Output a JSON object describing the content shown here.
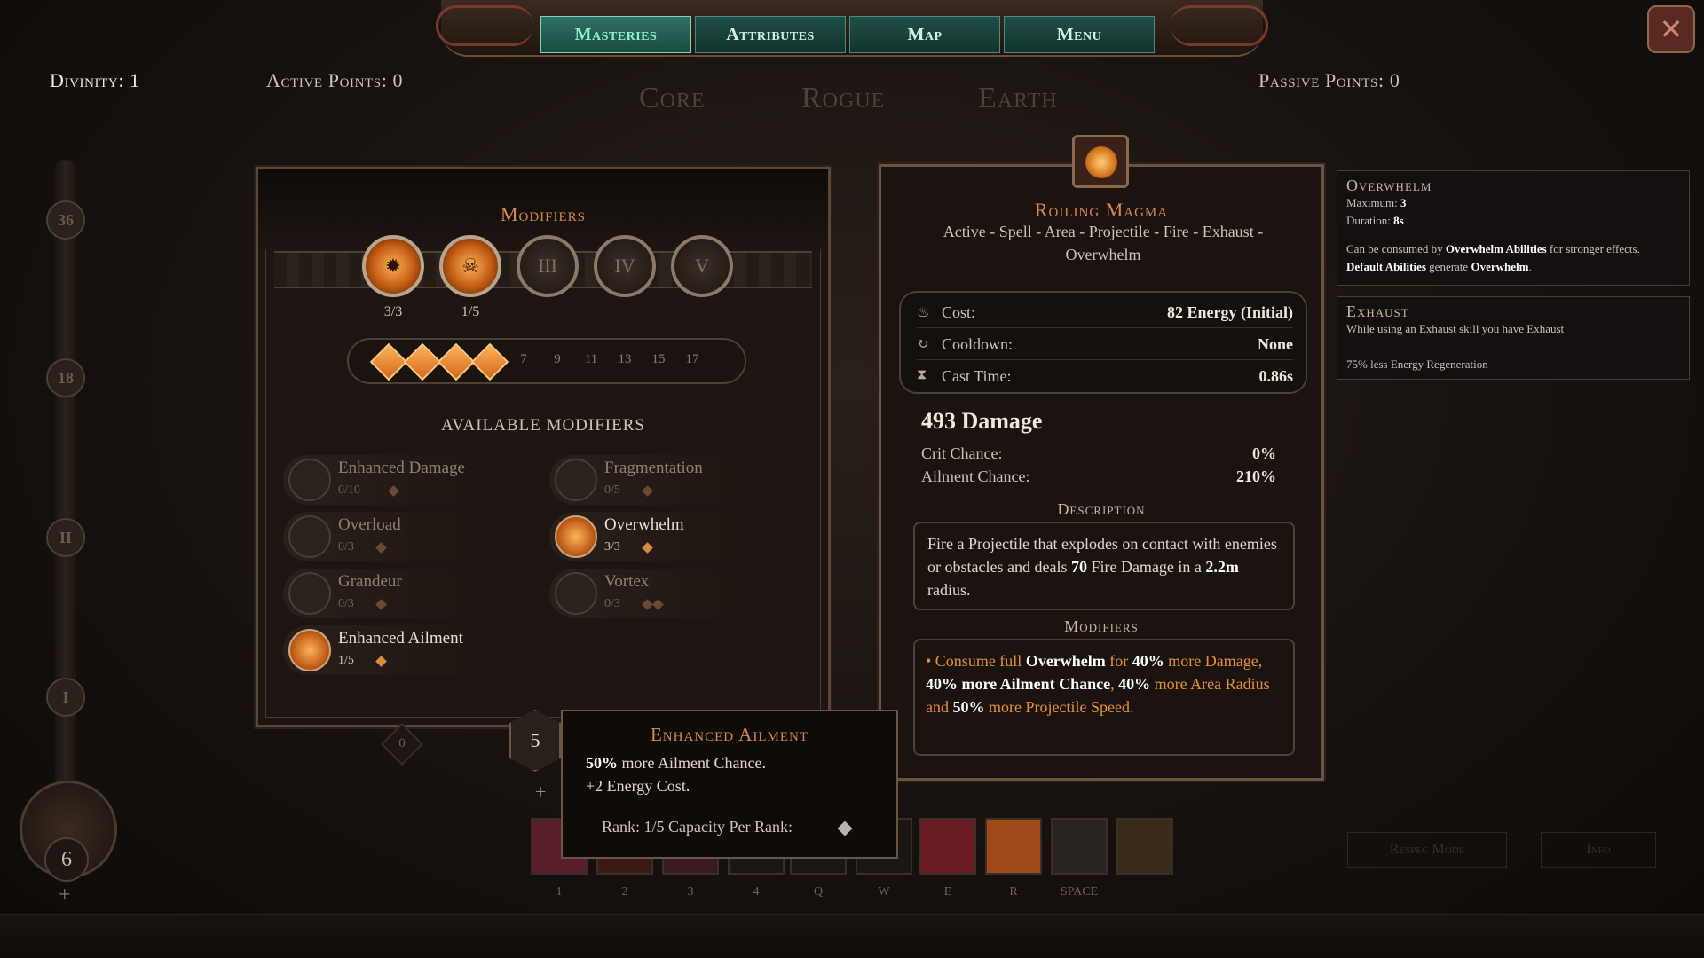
{
  "nav": {
    "tabs": [
      {
        "label": "Masteries",
        "active": true
      },
      {
        "label": "Attributes",
        "active": false
      },
      {
        "label": "Map",
        "active": false
      },
      {
        "label": "Menu",
        "active": false
      }
    ]
  },
  "header": {
    "divinity": "Divinity: 1",
    "active_points": "Active Points: 0",
    "passive_points": "Passive Points: 0",
    "tree_tabs": [
      "Core",
      "Rogue",
      "Earth"
    ]
  },
  "track": {
    "nodes": [
      "36",
      "18",
      "II",
      "I"
    ],
    "level": "6",
    "plus": "+"
  },
  "modifiers": {
    "title": "Modifiers",
    "slots": [
      {
        "label": "",
        "count": "3/3",
        "filled": true
      },
      {
        "label": "",
        "count": "1/5",
        "filled": true
      },
      {
        "label": "III",
        "count": "",
        "filled": false
      },
      {
        "label": "IV",
        "count": "",
        "filled": false
      },
      {
        "label": "V",
        "count": "",
        "filled": false
      }
    ],
    "rank_filled": 4,
    "rank_numbers": [
      "7",
      "9",
      "11",
      "13",
      "15",
      "17"
    ],
    "available_title": "AVAILABLE MODIFIERS",
    "items": [
      {
        "name": "Enhanced Damage",
        "count": "0/10",
        "active": false,
        "pips": 1
      },
      {
        "name": "Fragmentation",
        "count": "0/5",
        "active": false,
        "pips": 1
      },
      {
        "name": "Overload",
        "count": "0/3",
        "active": false,
        "pips": 1
      },
      {
        "name": "Overwhelm",
        "count": "3/3",
        "active": true,
        "pips": 1
      },
      {
        "name": "Grandeur",
        "count": "0/3",
        "active": false,
        "pips": 1
      },
      {
        "name": "Vortex",
        "count": "0/3",
        "active": false,
        "pips": 2
      },
      {
        "name": "Enhanced Ailment",
        "count": "1/5",
        "active": true,
        "pips": 1
      }
    ]
  },
  "skill": {
    "name": "Roiling Magma",
    "tags": "Active - Spell - Area - Projectile - Fire - Exhaust - Overwhelm",
    "stats": [
      {
        "icon": "energy-icon",
        "glyph": "♨",
        "label": "Cost:",
        "value": "82 Energy (Initial)"
      },
      {
        "icon": "cooldown-icon",
        "glyph": "↻",
        "label": "Cooldown:",
        "value": "None"
      },
      {
        "icon": "hourglass-icon",
        "glyph": "⧗",
        "label": "Cast Time:",
        "value": "0.86s"
      }
    ],
    "damage": "493 Damage",
    "crit_label": "Crit Chance:",
    "crit_value": "0%",
    "ailment_label": "Ailment Chance:",
    "ailment_value": "210%",
    "description_title": "Description",
    "description": {
      "p1": "Fire a Projectile that explodes on contact with enemies or obstacles and deals ",
      "b1": "70",
      "p2": " Fire Damage in a ",
      "b2": "2.2m",
      "p3": " radius."
    },
    "modifiers_title": "Modifiers",
    "modifier_summary": {
      "p1": "• Consume full ",
      "b1": "Overwhelm",
      "p2": " for ",
      "b2": "40%",
      "p3": " more Damage, ",
      "b3": "40% more Ailment Chance",
      "p4": ", ",
      "b4": "40%",
      "p5": " more Area Radius and ",
      "b5": "50%",
      "p6": " more Projectile Speed."
    }
  },
  "side_tips": {
    "overwhelm": {
      "title": "Overwhelm",
      "maximum_label": "Maximum:",
      "maximum_value": "3",
      "duration_label": "Duration:",
      "duration_value": "8s",
      "line_a": "Can be consumed by ",
      "line_a_b": "Overwhelm Abilities",
      "line_a_end": " for stronger effects.",
      "line_b_b1": "Default Abilities",
      "line_b": " generate ",
      "line_b_b2": "Overwhelm",
      "line_b_end": "."
    },
    "exhaust": {
      "title": "Exhaust",
      "line1": "While using an Exhaust skill you have Exhaust",
      "line2": "75% less Energy Regeneration"
    }
  },
  "tooltip": {
    "title": "Enhanced Ailment",
    "line1_b": "50%",
    "line1": " more Ailment Chance.",
    "line2": "+2 Energy Cost.",
    "rank": "Rank: 1/5   Capacity Per Rank:"
  },
  "point_badge": "5",
  "badge_plus": "+",
  "zero_badge": "0",
  "hotbar": {
    "keys": [
      "1",
      "2",
      "3",
      "4",
      "Q",
      "W",
      "E",
      "R",
      "SPACE",
      ""
    ],
    "slot_colors": [
      "#5a1e2a",
      "#3a1a14",
      "#3a1a1e",
      "#1a1614",
      "#1a1614",
      "#1a1614",
      "#6a1a22",
      "#a04a1a",
      "#2a2420",
      "#3a2a18"
    ]
  },
  "buttons": {
    "respec": "Respec Mode",
    "info": "Info",
    "close": "✕"
  }
}
